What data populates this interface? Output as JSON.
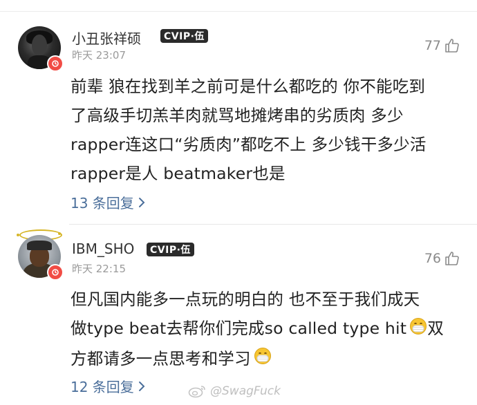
{
  "comments": [
    {
      "username": "小丑张祥硕",
      "vip_badge": "CVIP·伍",
      "time": "昨天 23:07",
      "likes": "77",
      "text_lines": [
        "前辈 狼在找到羊之前可是什么都吃的 你不能吃到",
        "了高级手切羔羊肉就骂地摊烤串的劣质肉 多少",
        "rapper连这口“劣质肉”都吃不上 多少钱干多少活",
        "rapper是人 beatmaker也是"
      ],
      "replies": "13 条回复"
    },
    {
      "username": "IBM_SHO",
      "vip_badge": "CVIP·伍",
      "time": "昨天 22:15",
      "likes": "76",
      "text_lines": [
        "但凡国内能多一点玩的明白的 也不至于我们成天",
        "做type beat去帮你们完成so called type hit",
        "方都请多一点思考和学习"
      ],
      "line2_tail": "双",
      "replies": "12 条回复"
    }
  ],
  "watermark": "@SwagFuck",
  "colors": {
    "accent_link": "#4a6e9a",
    "badge_red": "#f14c45",
    "vip_bg": "#2b2b2b"
  },
  "icons": [
    "thumbs-up-icon",
    "chevron-right-icon",
    "weibo-logo-icon",
    "mask-emoji-icon",
    "verified-badge-icon"
  ]
}
